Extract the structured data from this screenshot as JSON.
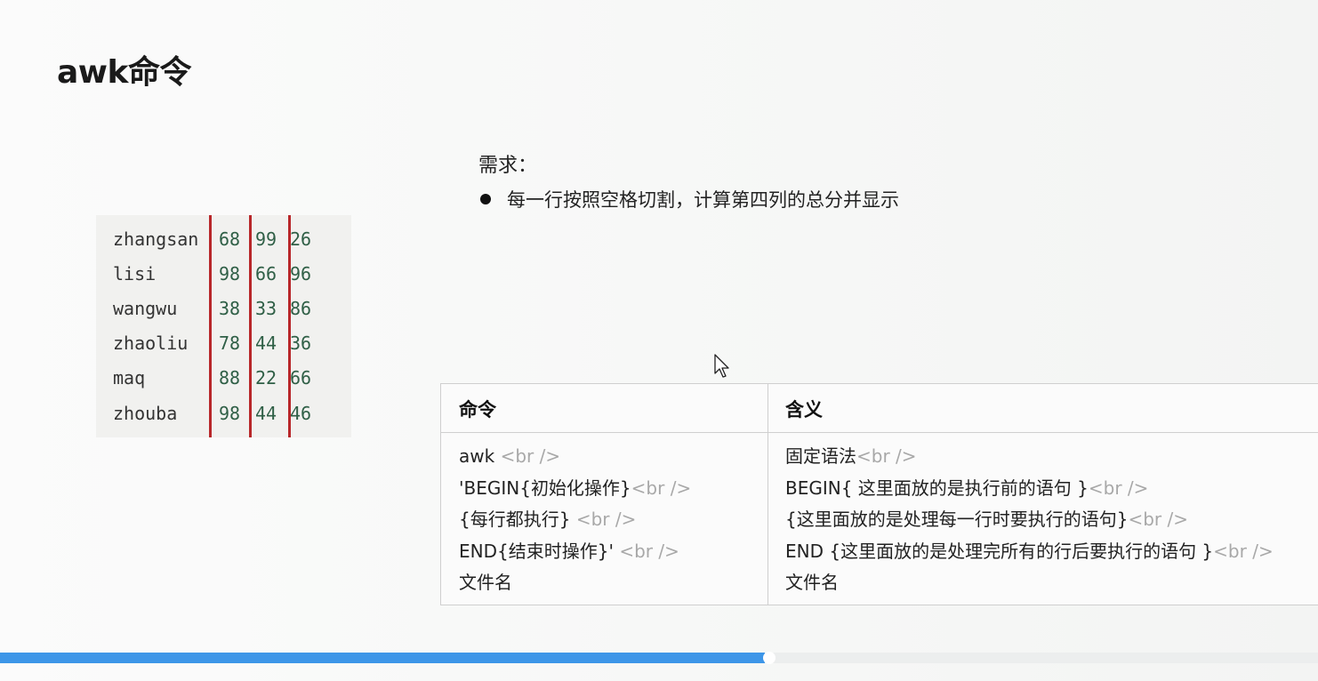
{
  "slide": {
    "title": "awk命令",
    "requirement": {
      "heading": "需求：",
      "bullet": "每一行按照空格切割，计算第四列的总分并显示"
    }
  },
  "data_block": {
    "rows": [
      {
        "name": "zhangsan",
        "c1": "68",
        "c2": "99",
        "c3": "26"
      },
      {
        "name": "lisi",
        "c1": "98",
        "c2": "66",
        "c3": "96"
      },
      {
        "name": "wangwu",
        "c1": "38",
        "c2": "33",
        "c3": "86"
      },
      {
        "name": "zhaoliu",
        "c1": "78",
        "c2": "44",
        "c3": "36"
      },
      {
        "name": "maq",
        "c1": "88",
        "c2": "22",
        "c3": "66"
      },
      {
        "name": "zhouba",
        "c1": "98",
        "c2": "44",
        "c3": "46"
      }
    ]
  },
  "table": {
    "headers": [
      "命令",
      "含义"
    ],
    "command_lines": [
      {
        "text": "awk ",
        "br": "<br />"
      },
      {
        "text": "'BEGIN{初始化操作}",
        "br": "<br />"
      },
      {
        "text": "{每行都执行} ",
        "br": "<br />"
      },
      {
        "text": "END{结束时操作}'  ",
        "br": "<br />"
      },
      {
        "text": "文件名",
        "br": ""
      }
    ],
    "meaning_lines": [
      {
        "text": "固定语法",
        "br": "<br />"
      },
      {
        "text": "BEGIN{ 这里面放的是执行前的语句 }",
        "br": "<br />"
      },
      {
        "text": "{这里面放的是处理每一行时要执行的语句}",
        "br": "<br />"
      },
      {
        "text": "END {这里面放的是处理完所有的行后要执行的语句 }",
        "br": "<br />"
      },
      {
        "text": "文件名",
        "br": ""
      }
    ]
  },
  "video": {
    "progress": 0.58
  },
  "colors": {
    "accent_line": "#b8272a",
    "progress": "#3d96e8",
    "number_text": "#2f5f46"
  }
}
